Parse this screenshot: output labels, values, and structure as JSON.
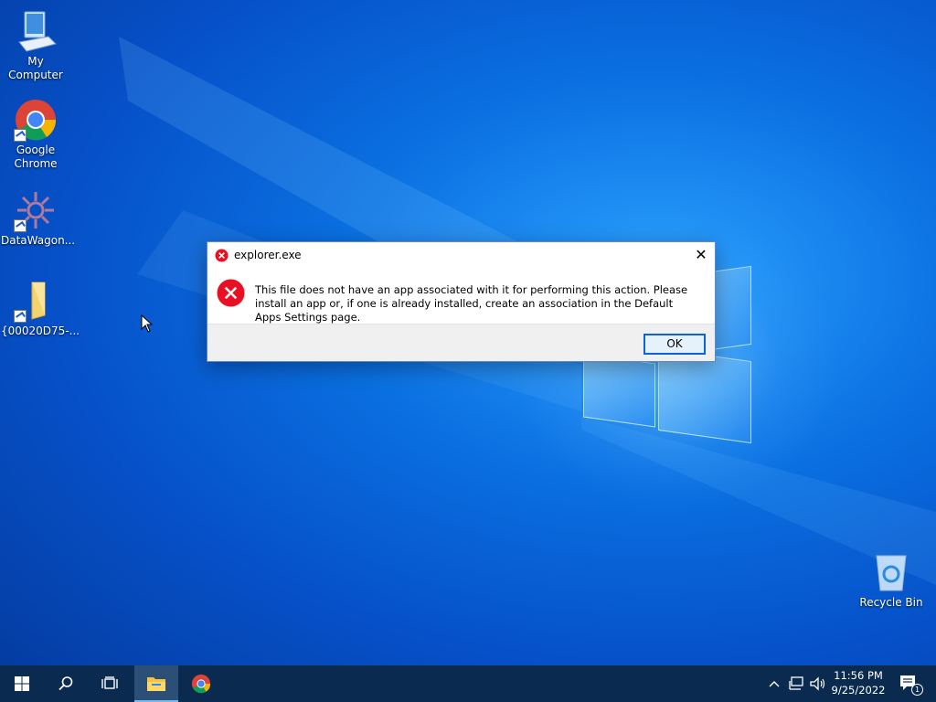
{
  "desktop": {
    "icons": [
      {
        "label": "My Computer",
        "icon": "computer-icon"
      },
      {
        "label": "Google Chrome",
        "icon": "chrome-icon"
      },
      {
        "label": "DataWagon...",
        "icon": "datawagon-icon"
      },
      {
        "label": "{00020D75-...",
        "icon": "folder-icon"
      },
      {
        "label": "Recycle Bin",
        "icon": "recycle-bin-icon"
      }
    ]
  },
  "dialog": {
    "title": "explorer.exe",
    "message": "This file does not have an app associated with it for performing this action. Please install an app or, if one is already installed, create an association in the Default Apps Settings page.",
    "ok_label": "OK",
    "close_symbol": "✕",
    "icon": "error-icon",
    "error_color": "#e81123"
  },
  "taskbar": {
    "items": [
      {
        "name": "start",
        "icon": "windows-start-icon"
      },
      {
        "name": "search",
        "icon": "search-icon"
      },
      {
        "name": "task-view",
        "icon": "task-view-icon"
      },
      {
        "name": "file-explorer",
        "icon": "folder-icon",
        "active": true
      },
      {
        "name": "chrome",
        "icon": "chrome-icon"
      }
    ],
    "tray": {
      "icons": [
        "chevron-up-icon",
        "network-icon",
        "volume-icon"
      ],
      "time": "11:56 PM",
      "date": "9/25/2022",
      "notification_count": "1"
    }
  },
  "colors": {
    "accent": "#0a64d8",
    "taskbar": "#0b2a4f",
    "desktop": "#0a6fe0"
  }
}
